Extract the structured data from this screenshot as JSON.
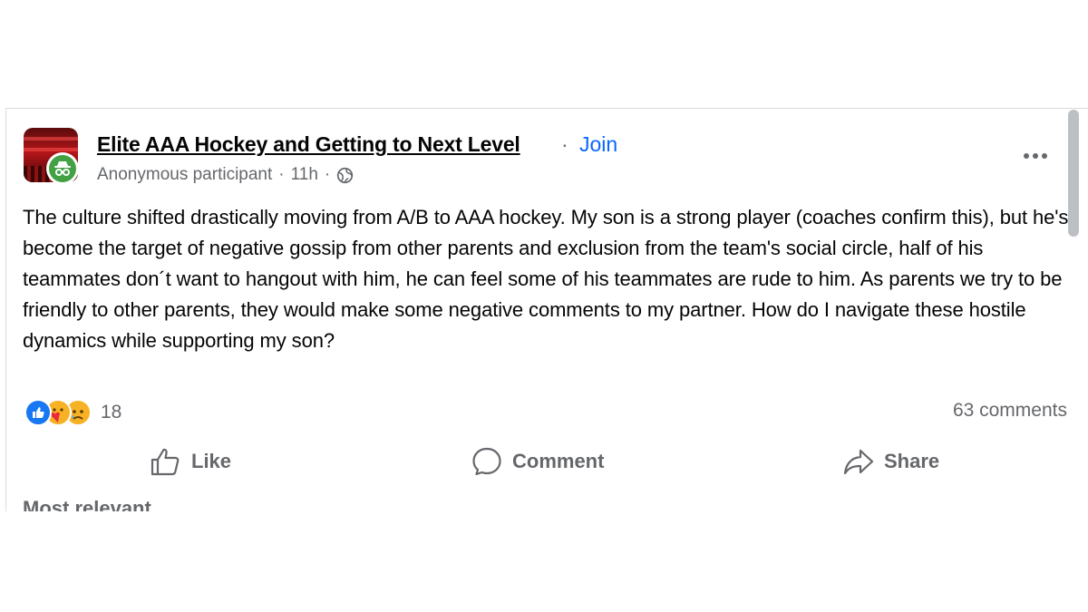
{
  "post": {
    "group_name": "Elite AAA Hockey and Getting to Next Level",
    "separator": "·",
    "join_label": "Join",
    "author": "Anonymous participant",
    "time": "11h",
    "visibility_icon": "globe-icon",
    "more_icon": "more-horizontal-icon",
    "body": "The culture shifted drastically moving from A/B to AAA hockey. My son is a strong player (coaches confirm this), but he's become the target of negative gossip from other parents and exclusion from the team's social circle, half of his teammates don´t want to hangout with him, he can feel some of his teammates are rude to him. As parents we try to be friendly to other parents, they would make some negative comments to my partner. How do I navigate these hostile dynamics while supporting my son?",
    "reactions": {
      "icons": [
        "like-reaction-icon",
        "care-reaction-icon",
        "sad-reaction-icon"
      ],
      "count": "18"
    },
    "comments_count": "63 comments",
    "actions": {
      "like": "Like",
      "comment": "Comment",
      "share": "Share"
    },
    "cutoff_label": "Most relevant"
  },
  "colors": {
    "join_blue": "#0866ff",
    "secondary_text": "#65676b",
    "primary_text": "#050505",
    "anon_badge_green": "#42a145",
    "like_blue": "#1877f2",
    "emoji_yellow": "#f7b125"
  }
}
